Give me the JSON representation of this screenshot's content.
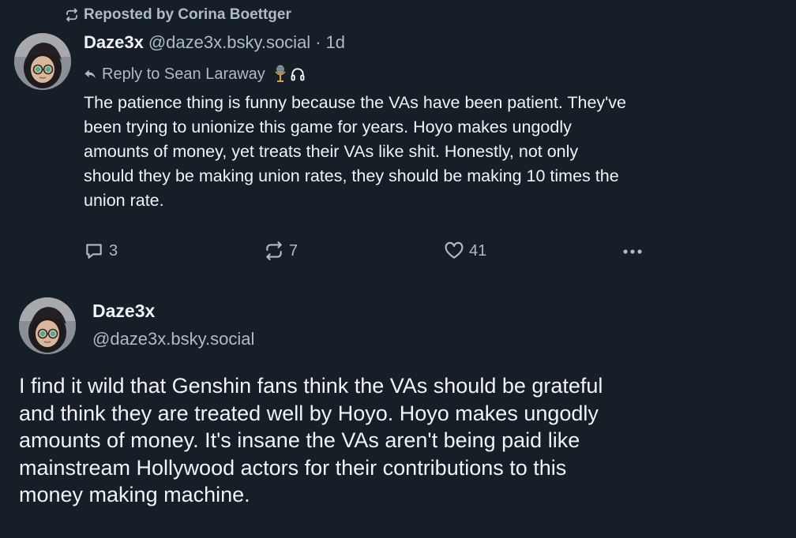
{
  "repost": {
    "text": "Reposted by Corina Boettger",
    "icon": "repost-icon"
  },
  "post1": {
    "author": {
      "display_name": "Daze3x",
      "handle": "@daze3x.bsky.social",
      "separator": "·",
      "time": "1d"
    },
    "reply": {
      "text": "Reply to Sean Laraway",
      "icons": [
        "reply-arrow-icon",
        "microphone-icon",
        "headphones-icon"
      ]
    },
    "body_lines": [
      "The patience thing is funny because the VAs have been patient. They've",
      "been trying to unionize this game for years. Hoyo makes ungodly",
      "amounts of money, yet treats their VAs like shit. Honestly, not only",
      "should they be making union rates, they should be making 10 times the",
      "union rate."
    ],
    "actions": {
      "replies": "3",
      "reposts": "7",
      "likes": "41"
    }
  },
  "post2": {
    "author": {
      "display_name": "Daze3x",
      "handle": "@daze3x.bsky.social"
    },
    "body_lines": [
      "I find it wild that Genshin fans think the VAs should be grateful",
      "and think they are treated well by Hoyo. Hoyo makes ungodly",
      "amounts of money. It's insane the VAs aren't being paid like",
      "mainstream Hollywood actors for their contributions to this",
      "money making machine."
    ]
  },
  "colors": {
    "background": "#161e27",
    "text": "#f1f3f5",
    "muted": "#aebbc9"
  }
}
